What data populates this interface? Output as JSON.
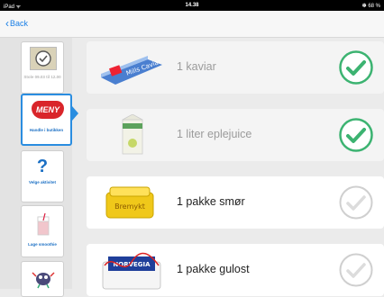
{
  "status_bar": {
    "carrier": "iPad ᯤ",
    "time": "14.38",
    "battery": "✽ 68 %"
  },
  "nav": {
    "back_label": "Back"
  },
  "sidebar": {
    "items": [
      {
        "label": "Stole 09.03 til 12.00"
      },
      {
        "label": "Handle i butikken",
        "logo_text": "MENY"
      },
      {
        "label": "Velge aktivitet",
        "symbol": "?"
      },
      {
        "label": "Lage smoothie"
      },
      {
        "label": ""
      }
    ]
  },
  "items": [
    {
      "text": "1 kaviar",
      "done": true,
      "product_text": "Mills Caviar"
    },
    {
      "text": "1 liter eplejuice",
      "done": true
    },
    {
      "text": "1 pakke smør",
      "done": false,
      "product_text": "Bremykt"
    },
    {
      "text": "1 pakke gulost",
      "done": false,
      "product_text": "NORVEGIA"
    }
  ],
  "colors": {
    "accent": "#2a8de0",
    "check_green": "#3cb371",
    "check_idle": "#d8d8d8"
  }
}
